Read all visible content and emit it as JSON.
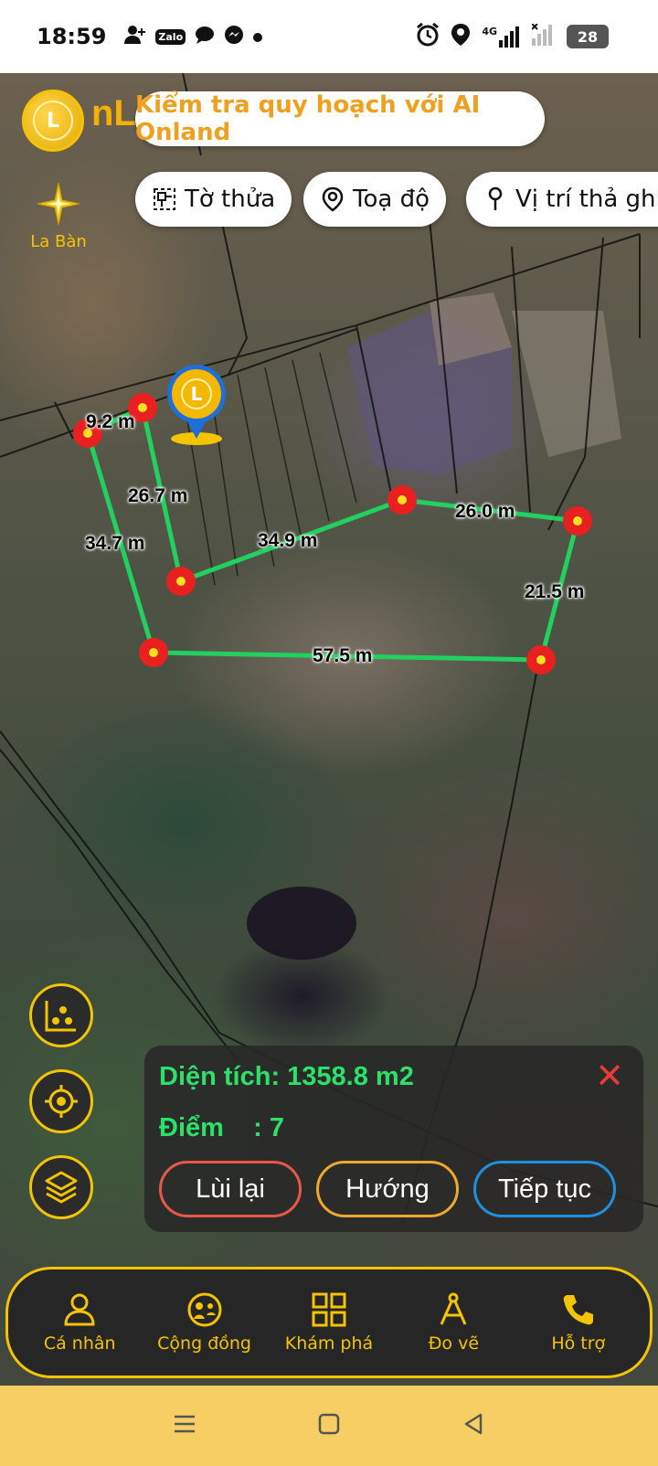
{
  "status_bar": {
    "time": "18:59",
    "left_icons": [
      "add-user-icon",
      "zalo-icon",
      "chat-icon",
      "messenger-icon",
      "dot-icon"
    ],
    "network": "4G",
    "battery": "28"
  },
  "header": {
    "logo_text": "nL",
    "ai_banner": "Kiểm tra quy hoạch với AI Onland"
  },
  "chips": [
    {
      "label": "Tờ thửa",
      "icon": "parcel-icon"
    },
    {
      "label": "Toạ độ",
      "icon": "location-pin-icon"
    },
    {
      "label": "Vị trí thả ghim",
      "icon": "pin-drop-icon"
    }
  ],
  "compass": {
    "label": "La Bàn"
  },
  "measurements": {
    "d1": "9.2 m",
    "d2": "26.7 m",
    "d3": "34.7 m",
    "d4": "34.9 m",
    "d5": "26.0 m",
    "d6": "21.5 m",
    "d7": "57.5 m"
  },
  "side_buttons": [
    "chart-icon",
    "target-icon",
    "layers-icon"
  ],
  "panel": {
    "area_label": "Diện tích: 1358.8 m2",
    "points_label": "Điểm    : 7",
    "close_icon": "close-icon",
    "back_button": "Lùi lại",
    "direction_button": "Hướng",
    "continue_button": "Tiếp tục"
  },
  "nav": [
    {
      "label": "Cá nhân",
      "icon": "person-icon"
    },
    {
      "label": "Cộng đồng",
      "icon": "community-icon"
    },
    {
      "label": "Khám phá",
      "icon": "grid-icon"
    },
    {
      "label": "Đo vẽ",
      "icon": "compass-drawing-icon"
    },
    {
      "label": "Hỗ trợ",
      "icon": "phone-icon"
    }
  ],
  "colors": {
    "accent": "#f5c400",
    "measure_line": "#22d060",
    "vertex": "#e82020",
    "area_text": "#2ee06a"
  }
}
